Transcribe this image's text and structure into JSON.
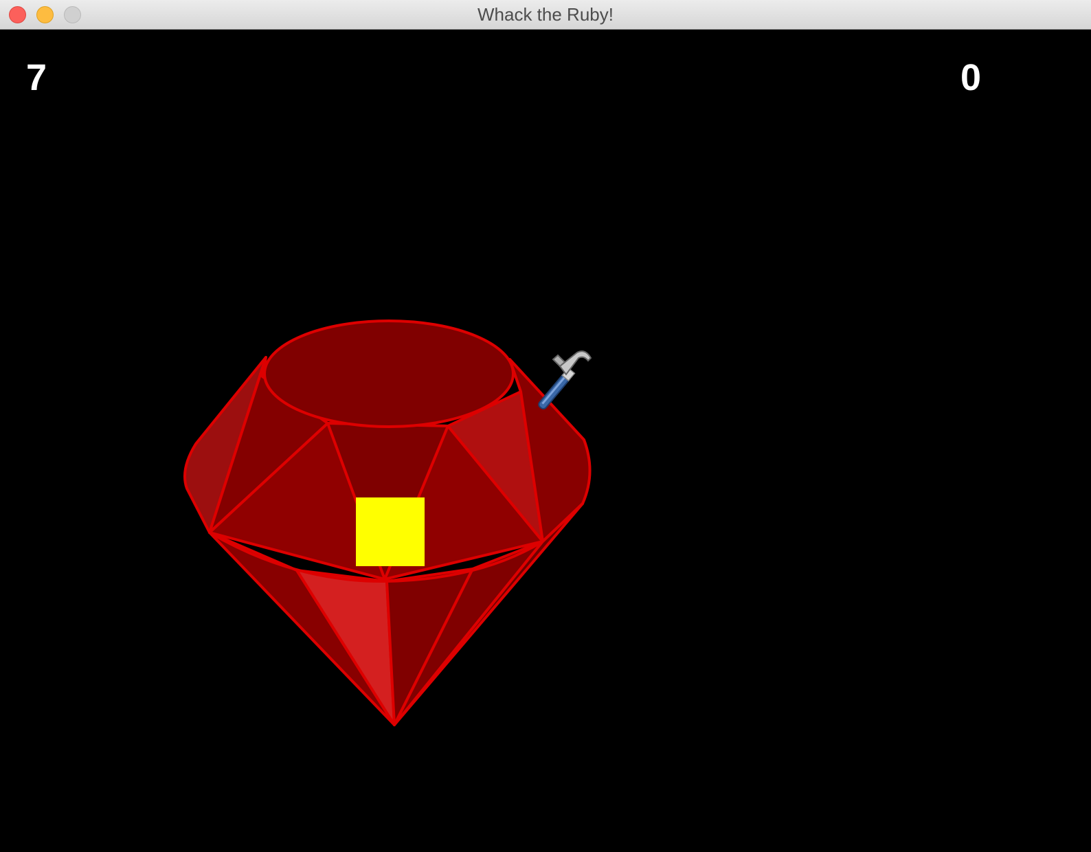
{
  "window": {
    "title": "Whack the Ruby!"
  },
  "hud": {
    "left_counter": "7",
    "right_counter": "0"
  },
  "colors": {
    "background": "#000000",
    "ruby_dark": "#800000",
    "ruby_mid": "#990000",
    "ruby_light": "#d42020",
    "ruby_edge": "#dd0000",
    "target": "#ffff00",
    "text": "#ffffff"
  },
  "icons": {
    "cursor": "hammer-icon",
    "sprite": "ruby-gem"
  }
}
